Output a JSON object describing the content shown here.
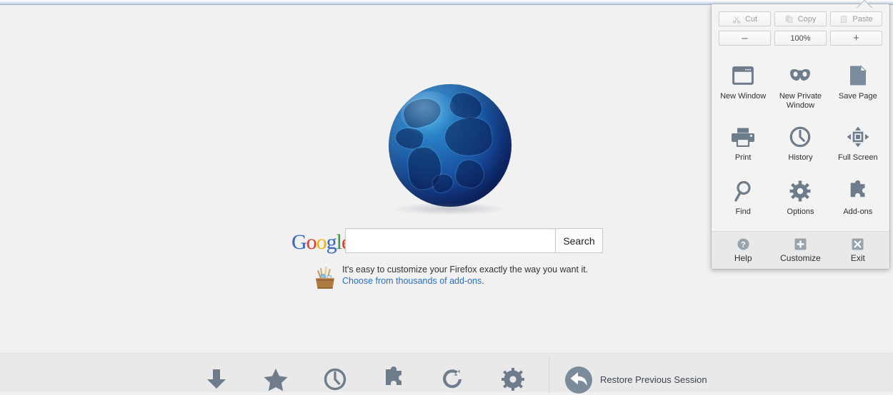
{
  "window": {
    "title_bar_visible": true
  },
  "page": {
    "globe_alt": "firefox-start-page-globe",
    "search": {
      "engine_logo": "Google",
      "logo_letters": [
        {
          "ch": "G",
          "color": "#3b69c4"
        },
        {
          "ch": "o",
          "color": "#dd3f2f"
        },
        {
          "ch": "o",
          "color": "#f2b50f"
        },
        {
          "ch": "g",
          "color": "#3b69c4"
        },
        {
          "ch": "l",
          "color": "#3a9b46"
        },
        {
          "ch": "e",
          "color": "#dd3f2f"
        }
      ],
      "input_value": "",
      "input_placeholder": "",
      "button_label": "Search"
    },
    "promo": {
      "icon": "addons-toolbox-icon",
      "text_before": "It's easy to customize your Firefox exactly the way you want it. ",
      "link_text": "Choose from thousands of add-ons",
      "text_after": "."
    }
  },
  "bottom_bar": {
    "items": [
      {
        "icon": "download-icon",
        "name": "downloads"
      },
      {
        "icon": "star-icon",
        "name": "bookmarks"
      },
      {
        "icon": "clock-icon",
        "name": "history"
      },
      {
        "icon": "puzzle-icon",
        "name": "addons"
      },
      {
        "icon": "sync-icon",
        "name": "sync"
      },
      {
        "icon": "gear-icon",
        "name": "settings"
      }
    ],
    "restore": {
      "icon": "restore-arrow-icon",
      "label": "Restore Previous Session"
    }
  },
  "menu_panel": {
    "edit_row": [
      {
        "label": "Cut",
        "icon": "scissors-icon",
        "disabled": true
      },
      {
        "label": "Copy",
        "icon": "copy-icon",
        "disabled": true
      },
      {
        "label": "Paste",
        "icon": "clipboard-icon",
        "disabled": true
      }
    ],
    "zoom_row": {
      "minus_label": "–",
      "level": "100%",
      "plus_label": "+"
    },
    "grid": [
      {
        "label": "New Window",
        "icon": "window-icon"
      },
      {
        "label": "New Private Window",
        "icon": "mask-icon"
      },
      {
        "label": "Save Page",
        "icon": "page-icon"
      },
      {
        "label": "Print",
        "icon": "printer-icon"
      },
      {
        "label": "History",
        "icon": "clock-icon"
      },
      {
        "label": "Full Screen",
        "icon": "fullscreen-icon"
      },
      {
        "label": "Find",
        "icon": "magnifier-icon"
      },
      {
        "label": "Options",
        "icon": "gear-icon"
      },
      {
        "label": "Add-ons",
        "icon": "puzzle-icon"
      }
    ],
    "footer": [
      {
        "label": "Help",
        "icon": "question-circle-icon"
      },
      {
        "label": "Customize",
        "icon": "plus-square-icon"
      },
      {
        "label": "Exit",
        "icon": "close-square-icon"
      }
    ]
  },
  "colors": {
    "page_bg": "#f1f1f1",
    "bottom_bar_bg": "#e9e9e9",
    "panel_bg": "#f3f3f3",
    "panel_footer_bg": "#e9e9e9",
    "icon_gray": "#6e7c8c",
    "link_blue": "#2b6fc2"
  }
}
